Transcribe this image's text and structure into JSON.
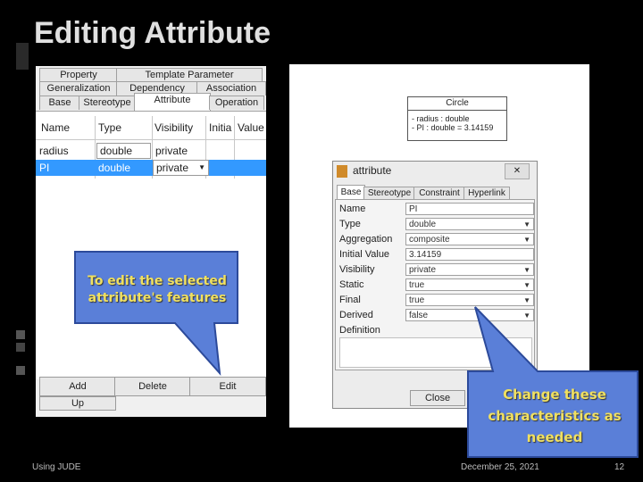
{
  "slide": {
    "title": "Editing Attribute",
    "footer_left": "Using JUDE",
    "footer_date": "December 25, 2021",
    "footer_page": "12"
  },
  "left_panel": {
    "tabs_row1": [
      "Property",
      "Template Parameter"
    ],
    "tabs_row2": [
      "Generalization",
      "Dependency",
      "Association"
    ],
    "tabs_row3": [
      "Base",
      "Stereotype",
      "Attribute",
      "Operation"
    ],
    "active_tab": "Attribute",
    "columns": [
      "Name",
      "Type",
      "Visibility",
      "Initia",
      "Value"
    ],
    "rows": [
      {
        "name": "radius",
        "type": "double",
        "visibility": "private"
      },
      {
        "name": "PI",
        "type": "double",
        "visibility": "private"
      }
    ],
    "buttons": [
      "Add",
      "Delete",
      "Edit"
    ],
    "buttons_row2_fragment": "Up",
    "callout": "To edit the selected attribute's features"
  },
  "class_diagram": {
    "name": "Circle",
    "attr1": "- radius : double",
    "attr2": "- PI : double = 3.14159"
  },
  "dialog": {
    "title": "attribute",
    "close_x": "✕",
    "tabs": [
      "Base",
      "Stereotype",
      "Constraint",
      "Hyperlink"
    ],
    "fields": [
      {
        "label": "Name",
        "value": "PI",
        "dropdown": false
      },
      {
        "label": "Type",
        "value": "double",
        "dropdown": true
      },
      {
        "label": "Aggregation",
        "value": "composite",
        "dropdown": true
      },
      {
        "label": "Initial Value",
        "value": "3.14159",
        "dropdown": false
      },
      {
        "label": "Visibility",
        "value": "private",
        "dropdown": true
      },
      {
        "label": "Static",
        "value": "true",
        "dropdown": true
      },
      {
        "label": "Final",
        "value": "true",
        "dropdown": true
      },
      {
        "label": "Derived",
        "value": "false",
        "dropdown": true
      }
    ],
    "definition_label": "Definition",
    "close_button": "Close",
    "callout": "Change these characteristics as needed"
  },
  "colors": {
    "background": "#000000",
    "callout_fill": "#5a7fd8",
    "callout_text": "#f0e060",
    "selection": "#3399ff"
  }
}
